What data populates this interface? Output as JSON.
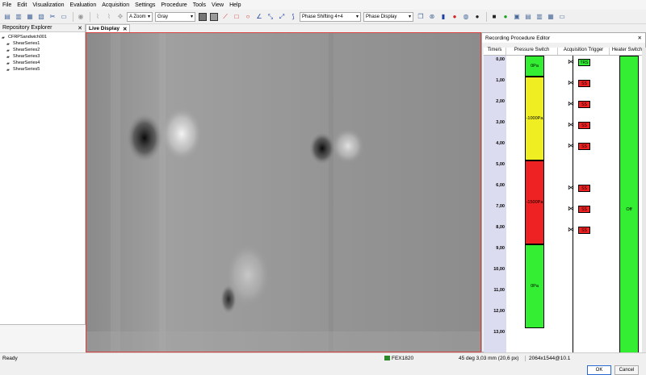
{
  "menu": [
    "File",
    "Edit",
    "Visualization",
    "Evaluation",
    "Acquisition",
    "Settings",
    "Procedure",
    "Tools",
    "View",
    "Help"
  ],
  "toolbar": {
    "zoom_value": "A Zoom",
    "colormap_value": "Gray",
    "method_value": "Phase Shifting 4+4",
    "display_value": "Phase Display"
  },
  "repository": {
    "title": "Repository Explorer",
    "root": "CFRPSandwich001",
    "items": [
      "ShearSeries1",
      "ShearSeries2",
      "ShearSeries3",
      "ShearSeries4",
      "ShearSeries5"
    ]
  },
  "live_display": {
    "tab_label": "Live Display"
  },
  "recording_editor": {
    "title": "Recording Procedure Editor",
    "columns": [
      "Time/s",
      "Pressure Switch",
      "Acquisition Trigger",
      "Heater Switch"
    ],
    "time_ticks": [
      "0,00",
      "1,00",
      "2,00",
      "3,00",
      "4,00",
      "5,00",
      "6,00",
      "7,00",
      "8,00",
      "9,00",
      "10,00",
      "11,00",
      "12,00",
      "13,00"
    ],
    "pressure_segments": [
      {
        "label": "0Pa",
        "start": 0,
        "end": 1,
        "color": "#33ee33"
      },
      {
        "label": "-1000Pa",
        "start": 1,
        "end": 5,
        "color": "#eeee22"
      },
      {
        "label": "-1500Pa",
        "start": 5,
        "end": 9,
        "color": "#ee2222"
      },
      {
        "label": "0Pa",
        "start": 9,
        "end": 13,
        "color": "#33ee33"
      }
    ],
    "triggers": [
      {
        "time": 0,
        "label": "TRS",
        "color": "#33ee33"
      },
      {
        "time": 1,
        "label": "SS",
        "color": "#ee2222"
      },
      {
        "time": 2,
        "label": "SS",
        "color": "#ee2222"
      },
      {
        "time": 3,
        "label": "SS",
        "color": "#ee2222"
      },
      {
        "time": 4,
        "label": "SS",
        "color": "#ee2222"
      },
      {
        "time": 6,
        "label": "SS",
        "color": "#ee2222"
      },
      {
        "time": 7,
        "label": "SS",
        "color": "#ee2222"
      },
      {
        "time": 8,
        "label": "SS",
        "color": "#ee2222"
      }
    ],
    "heater_label": "Off",
    "ok_label": "OK",
    "cancel_label": "Cancel"
  },
  "status": {
    "ready": "Ready",
    "camera": "FEX1820",
    "shear": "45 deg 3,03 mm (20,6 px)",
    "resolution": "2064x1544@10.1"
  }
}
